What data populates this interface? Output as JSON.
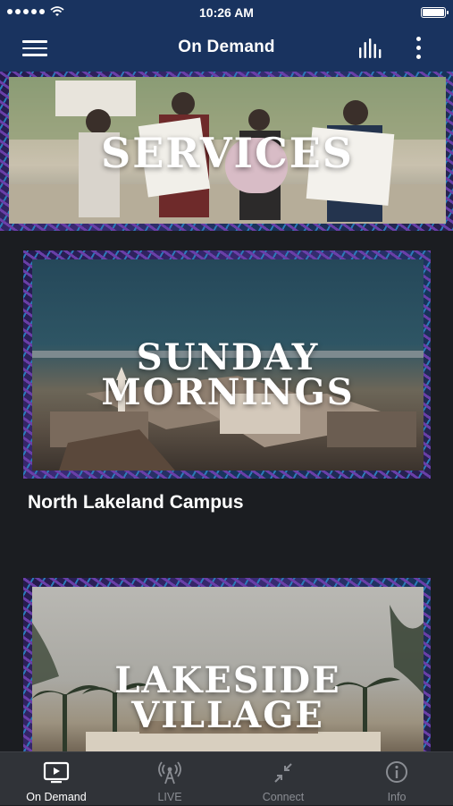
{
  "status_bar": {
    "time": "10:26 AM"
  },
  "header": {
    "title": "On Demand"
  },
  "cards": [
    {
      "title": "SERVICES"
    },
    {
      "title_line1": "SUNDAY",
      "title_line2": "MORNINGS",
      "caption": "North Lakeland Campus"
    },
    {
      "title_line1": "LAKESIDE",
      "title_line2": "VILLAGE"
    }
  ],
  "tabs": [
    {
      "label": "On Demand",
      "icon": "tv-icon",
      "active": true
    },
    {
      "label": "LIVE",
      "icon": "broadcast-icon",
      "active": false
    },
    {
      "label": "Connect",
      "icon": "connect-icon",
      "active": false
    },
    {
      "label": "Info",
      "icon": "info-icon",
      "active": false
    }
  ],
  "colors": {
    "nav": "#19335f",
    "background": "#1b1d21",
    "tabbar": "#303338",
    "tab_inactive": "#8a8d93"
  }
}
